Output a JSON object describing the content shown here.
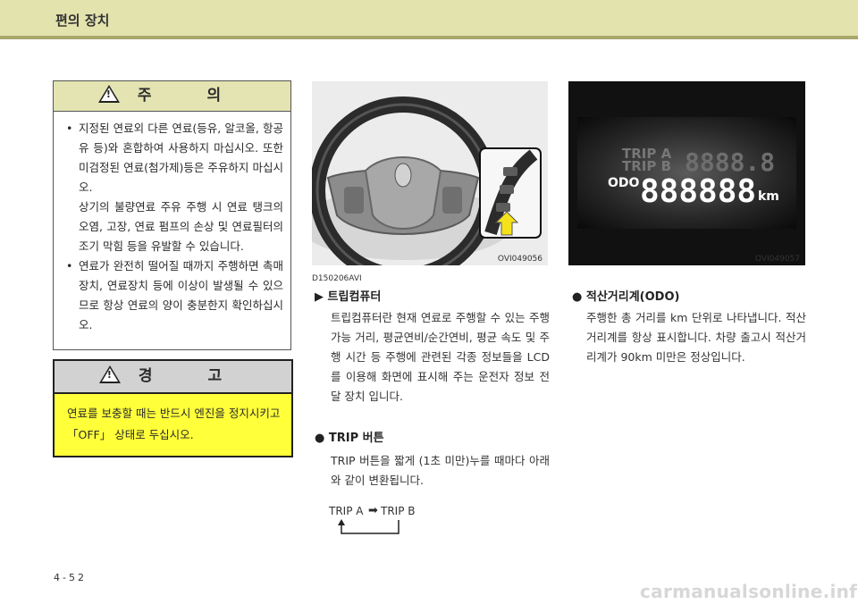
{
  "header": {
    "title": "편의 장치"
  },
  "caution": {
    "title": "주 의",
    "items": [
      {
        "paragraphs": [
          "지정된 연료외 다른 연료(등유, 알코올, 항공유 등)와 혼합하여 사용하지 마십시오. 또한 미검정된 연료(첨가제)등은 주유하지 마십시오.",
          "상기의 불량연료 주유 주행 시 연료 탱크의 오염, 고장, 연료 펌프의 손상 및 연료필터의 조기 막힘 등을 유발할 수 있습니다."
        ]
      },
      {
        "paragraphs": [
          "연료가 완전히 떨어질 때까지 주행하면 촉매장치, 연료장치 등에 이상이 발생될 수 있으므로 항상 연료의 양이 충분한지 확인하십시오."
        ]
      }
    ]
  },
  "warning": {
    "title": "경 고",
    "text": "연료를 보충할 때는 반드시 엔진을 정지시키고 「OFF」 상태로 두십시오."
  },
  "figures": {
    "steering_code": "OVI049056",
    "odo_code": "OVI049057",
    "cluster": {
      "trip_a": "TRIP A",
      "trip_b": "TRIP B",
      "odo_label": "ODO",
      "digits_small": "8888.8",
      "digits_big": "888888",
      "unit": "km"
    }
  },
  "doc_code": "D150206AVI",
  "trip_computer": {
    "title": "▶ 트립컴퓨터",
    "body": "트립컴퓨터란 현재 연료로 주행할 수 있는 주행 가능 거리, 평균연비/순간연비, 평균 속도 및 주행 시간 등 주행에 관련된 각종 정보들을 LCD를 이용해 화면에 표시해 주는 운전자 정보 전달 장치 입니다."
  },
  "trip_button": {
    "title": "● TRIP 버튼",
    "body": "TRIP 버튼을 짧게 (1초 미만)누를 때마다 아래와 같이 변환됩니다.",
    "from": "TRIP A",
    "to": "TRIP B"
  },
  "odometer": {
    "title": "● 적산거리계(ODO)",
    "body": "주행한 총 거리를 km 단위로 나타냅니다. 적산거리계를 항상 표시합니다. 차량 출고시 적산거리계가 90km 미만은 정상입니다."
  },
  "page_number": "4-52",
  "watermark": "carmanualsonline.info"
}
